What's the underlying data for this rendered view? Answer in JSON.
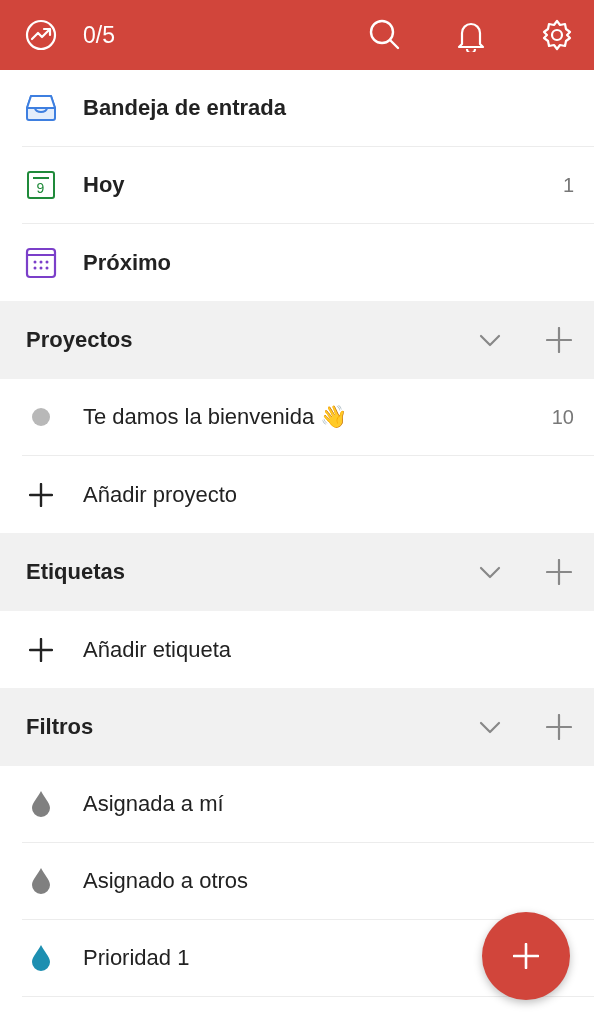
{
  "top_bar": {
    "karma": "0/5"
  },
  "nav": [
    {
      "kind": "inbox",
      "label": "Bandeja de entrada"
    },
    {
      "kind": "today",
      "label": "Hoy",
      "day": "9",
      "count": "1"
    },
    {
      "kind": "upcoming",
      "label": "Próximo"
    }
  ],
  "sections": [
    {
      "title": "Proyectos",
      "items": [
        {
          "kind": "project",
          "label": "Te damos la bienvenida 👋",
          "count": "10",
          "color": "#b8b8b8"
        },
        {
          "kind": "add",
          "label": "Añadir proyecto"
        }
      ]
    },
    {
      "title": "Etiquetas",
      "items": [
        {
          "kind": "add",
          "label": "Añadir etiqueta"
        }
      ]
    },
    {
      "title": "Filtros",
      "items": [
        {
          "kind": "filter",
          "label": "Asignada a mí",
          "color": "#808080"
        },
        {
          "kind": "filter",
          "label": "Asignado a otros",
          "color": "#808080"
        },
        {
          "kind": "filter",
          "label": "Prioridad 1",
          "color": "#1d8fb1"
        }
      ]
    }
  ]
}
